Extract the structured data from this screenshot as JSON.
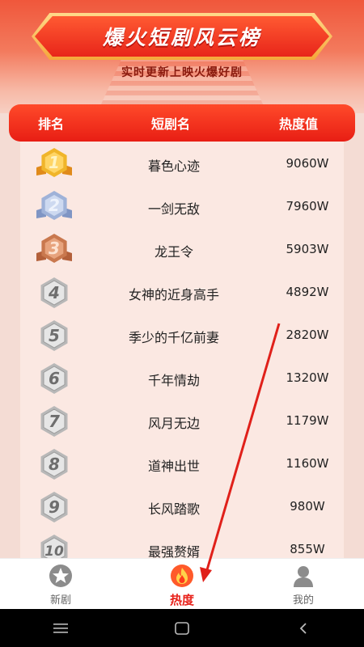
{
  "header": {
    "title": "爆火短剧风云榜",
    "subtitle": "实时更新上映火爆好剧"
  },
  "table": {
    "columns": [
      "排名",
      "短剧名",
      "热度值"
    ],
    "rows": [
      {
        "rank": "1",
        "name": "暮色心迹",
        "heat": "9060W",
        "medal": "gold"
      },
      {
        "rank": "2",
        "name": "一剑无敌",
        "heat": "7960W",
        "medal": "silver"
      },
      {
        "rank": "3",
        "name": "龙王令",
        "heat": "5903W",
        "medal": "bronze"
      },
      {
        "rank": "4",
        "name": "女神的近身高手",
        "heat": "4892W",
        "medal": "plain"
      },
      {
        "rank": "5",
        "name": "季少的千亿前妻",
        "heat": "2820W",
        "medal": "plain"
      },
      {
        "rank": "6",
        "name": "千年情劫",
        "heat": "1320W",
        "medal": "plain"
      },
      {
        "rank": "7",
        "name": "风月无边",
        "heat": "1179W",
        "medal": "plain"
      },
      {
        "rank": "8",
        "name": "道神出世",
        "heat": "1160W",
        "medal": "plain"
      },
      {
        "rank": "9",
        "name": "长风踏歌",
        "heat": "980W",
        "medal": "plain"
      },
      {
        "rank": "10",
        "name": "最强赘婿",
        "heat": "855W",
        "medal": "plain"
      }
    ]
  },
  "tabbar": {
    "tabs": [
      {
        "label": "新剧",
        "icon": "star-icon",
        "active": false
      },
      {
        "label": "热度",
        "icon": "flame-icon",
        "active": true
      },
      {
        "label": "我的",
        "icon": "user-icon",
        "active": false
      }
    ]
  },
  "colors": {
    "accent": "#e8211a",
    "banner_gold": "#f5a73a",
    "list_bg": "#fbe8e2",
    "arrow": "#e0201a"
  }
}
